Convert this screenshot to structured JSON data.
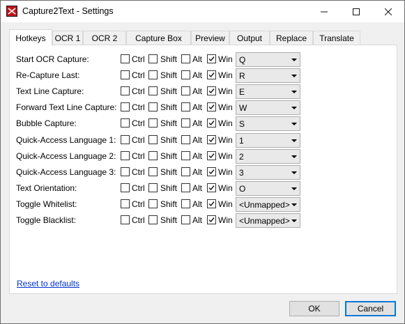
{
  "window": {
    "title": "Capture2Text - Settings"
  },
  "tabs": [
    "Hotkeys",
    "OCR 1",
    "OCR 2",
    "Capture Box",
    "Preview",
    "Output",
    "Replace",
    "Translate"
  ],
  "modifiers": {
    "ctrl": "Ctrl",
    "shift": "Shift",
    "alt": "Alt",
    "win": "Win"
  },
  "hotkeys": [
    {
      "label": "Start OCR Capture:",
      "ctrl": false,
      "shift": false,
      "alt": false,
      "win": true,
      "key": "Q"
    },
    {
      "label": "Re-Capture Last:",
      "ctrl": false,
      "shift": false,
      "alt": false,
      "win": true,
      "key": "R"
    },
    {
      "label": "Text Line Capture:",
      "ctrl": false,
      "shift": false,
      "alt": false,
      "win": true,
      "key": "E"
    },
    {
      "label": "Forward Text Line Capture:",
      "ctrl": false,
      "shift": false,
      "alt": false,
      "win": true,
      "key": "W"
    },
    {
      "label": "Bubble Capture:",
      "ctrl": false,
      "shift": false,
      "alt": false,
      "win": true,
      "key": "S"
    },
    {
      "label": "Quick-Access Language 1:",
      "ctrl": false,
      "shift": false,
      "alt": false,
      "win": true,
      "key": "1"
    },
    {
      "label": "Quick-Access Language 2:",
      "ctrl": false,
      "shift": false,
      "alt": false,
      "win": true,
      "key": "2"
    },
    {
      "label": "Quick-Access Language 3:",
      "ctrl": false,
      "shift": false,
      "alt": false,
      "win": true,
      "key": "3"
    },
    {
      "label": "Text Orientation:",
      "ctrl": false,
      "shift": false,
      "alt": false,
      "win": true,
      "key": "O"
    },
    {
      "label": "Toggle Whitelist:",
      "ctrl": false,
      "shift": false,
      "alt": false,
      "win": true,
      "key": "<Unmapped>"
    },
    {
      "label": "Toggle Blacklist:",
      "ctrl": false,
      "shift": false,
      "alt": false,
      "win": true,
      "key": "<Unmapped>"
    }
  ],
  "reset_link": "Reset to defaults",
  "buttons": {
    "ok": "OK",
    "cancel": "Cancel"
  },
  "colors": {
    "link": "#0033cc",
    "focus_border": "#0078d7"
  }
}
